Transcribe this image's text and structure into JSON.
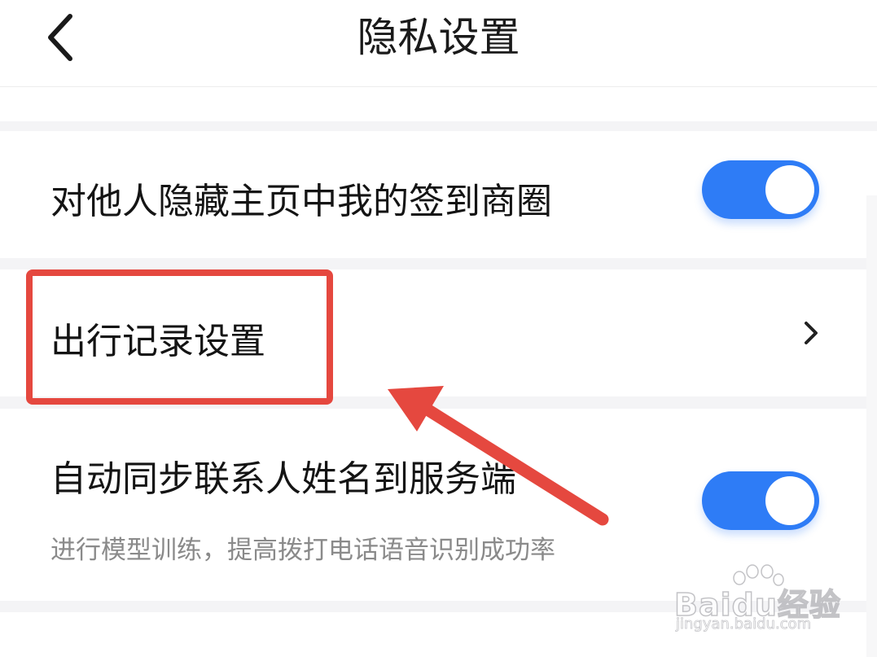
{
  "header": {
    "title": "隐私设置",
    "back_icon": "chevron-left-icon"
  },
  "settings": [
    {
      "label": "对他人隐藏主页中我的签到商圈",
      "control": "toggle",
      "state": "on"
    },
    {
      "label": "出行记录设置",
      "control": "chevron",
      "icon": "chevron-right-icon"
    },
    {
      "label": "自动同步联系人姓名到服务端",
      "sublabel": "进行模型训练，提高拨打电话语音识别成功率",
      "control": "toggle",
      "state": "on"
    }
  ],
  "watermark": {
    "brand": "Baidu经验",
    "url": "jingyan.baidu.com"
  },
  "colors": {
    "toggle_on": "#2e7cf6",
    "annotation_red": "#e5483f",
    "background": "#f4f4f6",
    "text_primary": "#141414",
    "text_secondary": "#8a8a8a"
  }
}
